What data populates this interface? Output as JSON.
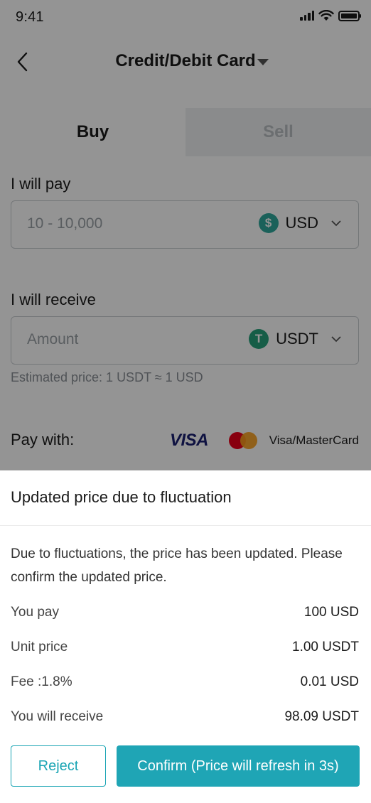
{
  "status_bar": {
    "time": "9:41"
  },
  "nav": {
    "title": "Credit/Debit Card"
  },
  "tabs": [
    {
      "label": "Buy"
    },
    {
      "label": "Sell"
    }
  ],
  "pay": {
    "label": "I will pay",
    "placeholder": "10 - 10,000",
    "currency": "USD",
    "coin_symbol": "$"
  },
  "receive": {
    "label": "I will receive",
    "placeholder": "Amount",
    "currency": "USDT",
    "coin_symbol": "T"
  },
  "estimated_price": "Estimated price: 1 USDT ≈ 1 USD",
  "pay_with": {
    "label": "Pay with:",
    "visa_logo": "VISA",
    "cards": "Visa/MasterCard"
  },
  "sheet": {
    "title": "Updated price due to fluctuation",
    "message": "Due to fluctuations, the price has been updated. Please confirm the updated price.",
    "rows": [
      {
        "label": "You pay",
        "value": "100 USD"
      },
      {
        "label": "Unit price",
        "value": "1.00 USDT"
      },
      {
        "label": "Fee :1.8%",
        "value": "0.01 USD"
      },
      {
        "label": "You will receive",
        "value": "98.09 USDT"
      }
    ],
    "reject_label": "Reject",
    "confirm_label": "Confirm (Price will refresh in 3s)"
  },
  "colors": {
    "accent": "#1fa5b5",
    "usd_coin": "#2fa89c",
    "usdt_coin": "#26a17b",
    "overlay": "rgba(0,0,0,0.42)"
  }
}
